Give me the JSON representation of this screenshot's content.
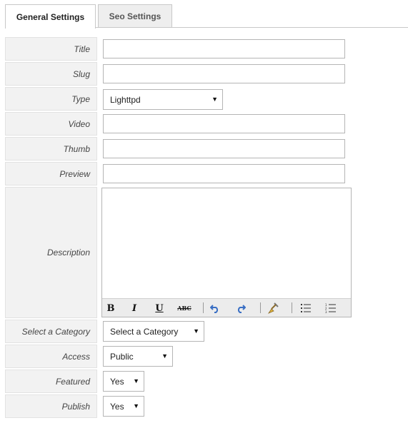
{
  "tabs": [
    {
      "label": "General Settings",
      "active": true
    },
    {
      "label": "Seo Settings",
      "active": false
    }
  ],
  "form": {
    "title": {
      "label": "Title",
      "value": ""
    },
    "slug": {
      "label": "Slug",
      "value": ""
    },
    "type": {
      "label": "Type",
      "selected": "Lighttpd"
    },
    "video": {
      "label": "Video",
      "value": ""
    },
    "thumb": {
      "label": "Thumb",
      "value": ""
    },
    "preview": {
      "label": "Preview",
      "value": ""
    },
    "description": {
      "label": "Description",
      "value": ""
    },
    "category": {
      "label": "Select a Category",
      "selected": "Select a Category"
    },
    "access": {
      "label": "Access",
      "selected": "Public"
    },
    "featured": {
      "label": "Featured",
      "selected": "Yes"
    },
    "publish": {
      "label": "Publish",
      "selected": "Yes"
    }
  },
  "editor_toolbar": {
    "bold": "B",
    "italic": "I",
    "underline": "U",
    "strikethrough": "ABC",
    "icons": [
      "bold-icon",
      "italic-icon",
      "underline-icon",
      "strikethrough-icon",
      "undo-icon",
      "redo-icon",
      "clean-format-icon",
      "bullet-list-icon",
      "numbered-list-icon"
    ]
  },
  "colors": {
    "label_bg": "#f2f2f2",
    "border": "#b5b5b5",
    "undo_redo": "#3a6fc4"
  }
}
